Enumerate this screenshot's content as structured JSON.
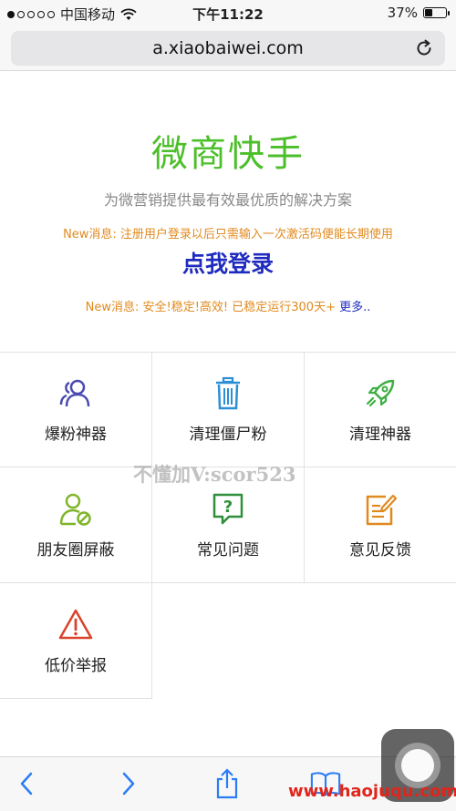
{
  "status_bar": {
    "carrier": "中国移动",
    "time": "下午11:22",
    "battery_text": "37%",
    "battery_level": 0.37
  },
  "browser": {
    "url": "a.xiaobaiwei.com"
  },
  "header": {
    "title": "微商快手",
    "subtitle": "为微营销提供最有效最优质的解决方案",
    "notice1": "New消息: 注册用户登录以后只需输入一次激活码便能长期使用",
    "login_label": "点我登录",
    "notice2_text": "New消息: 安全!稳定!高效! 已稳定运行300天+ ",
    "notice2_link": "更多.."
  },
  "menu": [
    {
      "label": "爆粉神器",
      "icon": "users-icon"
    },
    {
      "label": "清理僵尸粉",
      "icon": "trash-icon"
    },
    {
      "label": "清理神器",
      "icon": "rocket-icon"
    },
    {
      "label": "朋友圈屏蔽",
      "icon": "user-block-icon"
    },
    {
      "label": "常见问题",
      "icon": "question-bubble-icon"
    },
    {
      "label": "意见反馈",
      "icon": "edit-note-icon"
    },
    {
      "label": "低价举报",
      "icon": "warning-icon"
    }
  ],
  "watermark": "不懂加V:scor523",
  "site_watermark": "www.haojuqu.com",
  "colors": {
    "title_green": "#4cbf2a",
    "notice_orange": "#e08a1e",
    "link_blue": "#1f2bbf",
    "icon_purple": "#4b4ab0",
    "icon_blue": "#2b8fd6",
    "icon_green": "#3dae42",
    "icon_olive": "#7fb52a",
    "icon_darkgreen": "#2f8f3a",
    "icon_orange": "#e08a1e",
    "icon_red": "#d9432b",
    "toolbar_blue": "#2a7df6"
  }
}
